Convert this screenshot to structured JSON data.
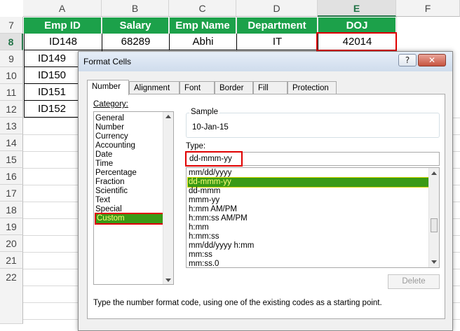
{
  "sheet": {
    "columns": [
      "A",
      "B",
      "C",
      "D",
      "E",
      "F"
    ],
    "selected_column": "E",
    "rows": [
      "7",
      "8",
      "9",
      "10",
      "11",
      "12",
      "13",
      "14",
      "15",
      "16",
      "17",
      "18",
      "19",
      "20",
      "21",
      "22"
    ],
    "selected_row": "8",
    "headers": [
      "Emp ID",
      "Salary",
      "Emp Name",
      "Department",
      "DOJ"
    ],
    "data_row": [
      "ID148",
      "68289",
      "Abhi",
      "IT",
      "42014"
    ],
    "partial_ids": [
      "ID149",
      "ID150",
      "ID151",
      "ID152"
    ],
    "header_fill": "#1ca14a",
    "highlight_color": "#e00000"
  },
  "dialog": {
    "title": "Format Cells",
    "help_button": "?",
    "close_button": "✕",
    "tabs": [
      "Number",
      "Alignment",
      "Font",
      "Border",
      "Fill",
      "Protection"
    ],
    "active_tab": "Number",
    "category_label": "Category:",
    "categories": [
      "General",
      "Number",
      "Currency",
      "Accounting",
      "Date",
      "Time",
      "Percentage",
      "Fraction",
      "Scientific",
      "Text",
      "Special",
      "Custom"
    ],
    "selected_category": "Custom",
    "sample_label": "Sample",
    "sample_value": "10-Jan-15",
    "type_label": "Type:",
    "type_value": "dd-mmm-yy",
    "formats": [
      "mm/dd/yyyy",
      "dd-mmm-yy",
      "dd-mmm",
      "mmm-yy",
      "h:mm AM/PM",
      "h:mm:ss AM/PM",
      "h:mm",
      "h:mm:ss",
      "mm/dd/yyyy h:mm",
      "mm:ss",
      "mm:ss.0"
    ],
    "selected_format": "dd-mmm-yy",
    "delete_button": "Delete",
    "hint": "Type the number format code, using one of the existing codes as a starting point.",
    "selection_fill": "#3a9a15",
    "selection_text": "#ffff7a"
  }
}
